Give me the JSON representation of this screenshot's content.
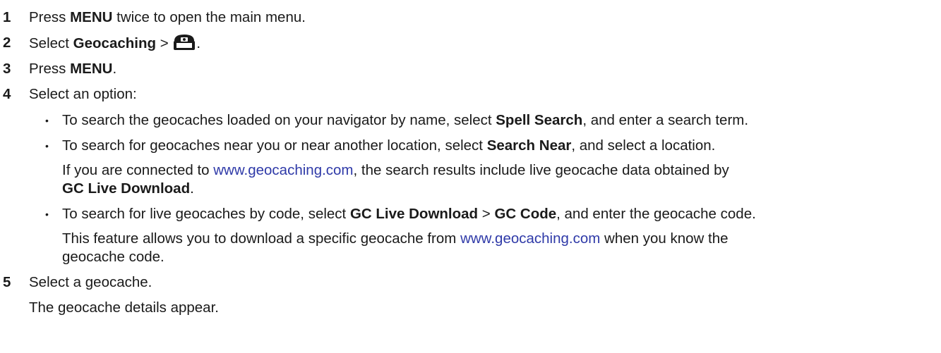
{
  "clipped_top_line": "(text clipped above)",
  "steps": [
    {
      "num": "1",
      "pre": "Press ",
      "bold": "MENU",
      "post": " twice to open the main menu."
    },
    {
      "num": "2",
      "pre": "Select ",
      "bold": "Geocaching",
      "sep": " > ",
      "post": "."
    },
    {
      "num": "3",
      "pre": "Press ",
      "bold": "MENU",
      "post": "."
    },
    {
      "num": "4",
      "text": "Select an option:"
    },
    {
      "num": "5",
      "text": "Select a geocache."
    }
  ],
  "options": [
    {
      "pre": "To search the geocaches loaded on your navigator by name, select ",
      "bold": "Spell Search",
      "post": ", and enter a search term."
    },
    {
      "pre": "To search for geocaches near you or near another location, select ",
      "bold": "Search Near",
      "post": ", and select a location.",
      "note_line1_pre": "If you are connected to ",
      "note_link": "www.geocaching.com",
      "note_line1_post": ", the search results include live geocache data obtained by",
      "note_line2_bold": "GC Live Download",
      "note_line2_post": "."
    },
    {
      "pre": "To search for live geocaches by code, select ",
      "bold1": "GC Live Download",
      "sep": " > ",
      "bold2": "GC Code",
      "post": ", and enter the geocache code.",
      "note_line1_pre": "This feature allows you to download a specific geocache from ",
      "note_link": "www.geocaching.com",
      "note_line1_post": " when you know the",
      "note_line2": "geocache code."
    }
  ],
  "step5_note": "The geocache details appear.",
  "icons": {
    "geocache_chest": "treasure-chest-icon",
    "bullet": "•"
  },
  "colors": {
    "text": "#1a1a1a",
    "link": "#2f3aa8"
  }
}
